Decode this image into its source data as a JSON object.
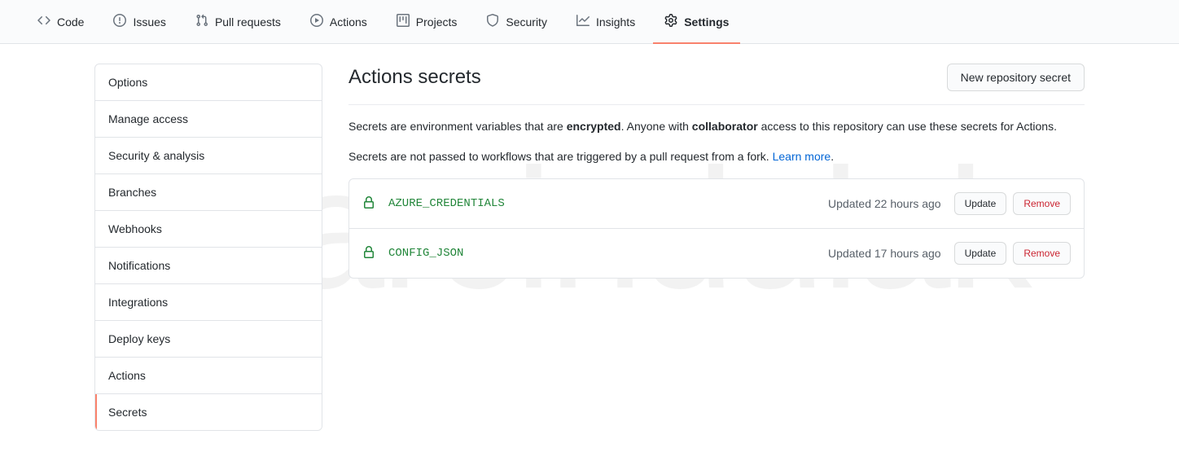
{
  "watermark": "marcindulak",
  "topnav": [
    {
      "label": "Code",
      "icon": "code"
    },
    {
      "label": "Issues",
      "icon": "issue"
    },
    {
      "label": "Pull requests",
      "icon": "pr"
    },
    {
      "label": "Actions",
      "icon": "play"
    },
    {
      "label": "Projects",
      "icon": "project"
    },
    {
      "label": "Security",
      "icon": "shield"
    },
    {
      "label": "Insights",
      "icon": "graph"
    },
    {
      "label": "Settings",
      "icon": "gear",
      "selected": true
    }
  ],
  "sidebar": {
    "items": [
      {
        "label": "Options"
      },
      {
        "label": "Manage access"
      },
      {
        "label": "Security & analysis"
      },
      {
        "label": "Branches"
      },
      {
        "label": "Webhooks"
      },
      {
        "label": "Notifications"
      },
      {
        "label": "Integrations"
      },
      {
        "label": "Deploy keys"
      },
      {
        "label": "Actions"
      },
      {
        "label": "Secrets",
        "active": true
      }
    ]
  },
  "page": {
    "title": "Actions secrets",
    "new_button": "New repository secret",
    "desc_part1": "Secrets are environment variables that are ",
    "desc_bold1": "encrypted",
    "desc_part2": ". Anyone with ",
    "desc_bold2": "collaborator",
    "desc_part3": " access to this repository can use these secrets for Actions.",
    "desc_line2a": "Secrets are not passed to workflows that are triggered by a pull request from a fork. ",
    "desc_link": "Learn more",
    "desc_line2b": "."
  },
  "secrets": [
    {
      "name": "AZURE_CREDENTIALS",
      "updated": "Updated 22 hours ago",
      "update_btn": "Update",
      "remove_btn": "Remove"
    },
    {
      "name": "CONFIG_JSON",
      "updated": "Updated 17 hours ago",
      "update_btn": "Update",
      "remove_btn": "Remove"
    }
  ]
}
